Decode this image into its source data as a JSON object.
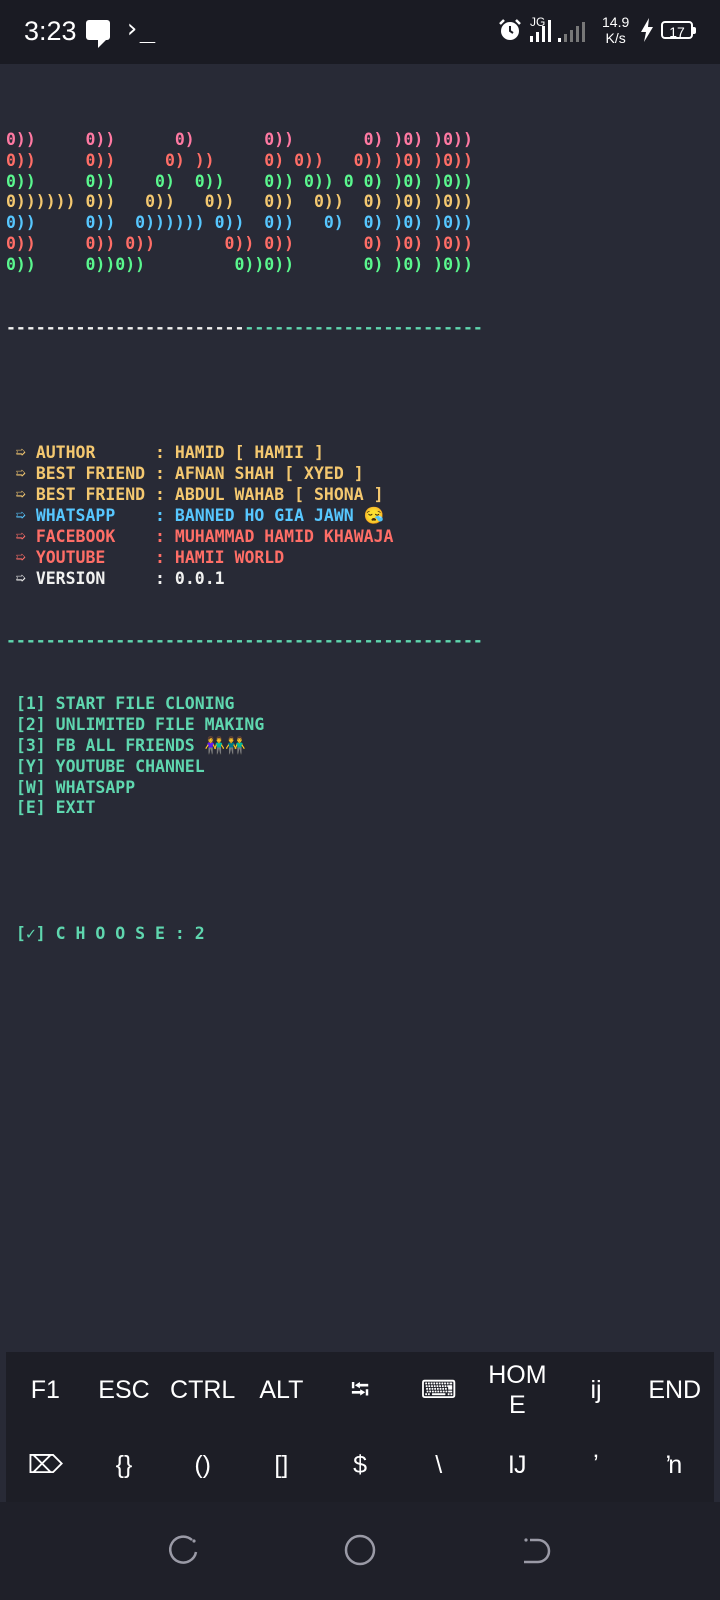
{
  "status_bar": {
    "time": "3:23",
    "terminal_glyph": "›_",
    "net_speed": "14.9",
    "net_unit": "K/s",
    "battery": "17"
  },
  "banner_lines": [
    [
      {
        "t": "0))     0))      0)       0))       0) )0) )0))",
        "c": "pink"
      }
    ],
    [
      {
        "t": "0))     0))     0) ))     0) 0))   0)) )0) )0))",
        "c": "red"
      }
    ],
    [
      {
        "t": "0))     0))    0)  0))    0)) 0)) 0 0) )0) )0))",
        "c": "green"
      }
    ],
    [
      {
        "t": "0)))))) 0))   0))   0))   0))  0))  0) )0) )0))",
        "c": "yellow"
      }
    ],
    [
      {
        "t": "0))     0))  0)))))) 0))  0))   0)  0) )0) )0))",
        "c": "cyan"
      }
    ],
    [
      {
        "t": "0))     0)) 0))       0)) 0))       0) )0) )0))",
        "c": "red"
      }
    ],
    [
      {
        "t": "0))     0))0))         0))0))       0) )0) )0))",
        "c": "green"
      }
    ]
  ],
  "separator_left": "------------------------",
  "separator_right": "------------------------",
  "info": [
    {
      "bullet": " ➯ ",
      "label": "AUTHOR      ",
      "sep": ": ",
      "value": "HAMID [ HAMII ]",
      "c": "yellow"
    },
    {
      "bullet": " ➯ ",
      "label": "BEST FRIEND ",
      "sep": ": ",
      "value": "AFNAN SHAH [ XYED ]",
      "c": "yellow"
    },
    {
      "bullet": " ➯ ",
      "label": "BEST FRIEND ",
      "sep": ": ",
      "value": "ABDUL WAHAB [ SHONA ]",
      "c": "yellow"
    },
    {
      "bullet": " ➯ ",
      "label": "WHATSAPP    ",
      "sep": ": ",
      "value": "BANNED HO GIA JAWN 😪",
      "c": "cyan"
    },
    {
      "bullet": " ➯ ",
      "label": "FACEBOOK    ",
      "sep": ": ",
      "value": "MUHAMMAD HAMID KHAWAJA",
      "c": "red"
    },
    {
      "bullet": " ➯ ",
      "label": "YOUTUBE     ",
      "sep": ": ",
      "value": "HAMII WORLD",
      "c": "red"
    },
    {
      "bullet": " ➯ ",
      "label": "VERSION     ",
      "sep": ": ",
      "value": "0.0.1",
      "c": "white"
    }
  ],
  "separator_full": "------------------------------------------------",
  "menu": [
    " [1] START FILE CLONING",
    " [2] UNLIMITED FILE MAKING",
    " [3] FB ALL FRIENDS 👫👬",
    " [Y] YOUTUBE CHANNEL",
    " [W] WHATSAPP",
    " [E] EXIT"
  ],
  "prompt": " [✓] C H O O S E : 2",
  "extra_keys": {
    "row1": [
      "F1",
      "ESC",
      "CTRL",
      "ALT",
      "⭾",
      "⌨",
      "HOM\nE",
      "ĳ",
      "END"
    ],
    "row2": [
      "⌦",
      "{}",
      "()",
      "[]",
      "$",
      "\\",
      "Ĳ",
      "ʼ",
      "ŉ"
    ]
  },
  "colors": {
    "background": "#282a36",
    "red": "#ff6e67",
    "pink": "#ff79a2",
    "green": "#5af78e",
    "yellow": "#f4c870",
    "cyan": "#57c7ff",
    "teal": "#5fd7af"
  }
}
